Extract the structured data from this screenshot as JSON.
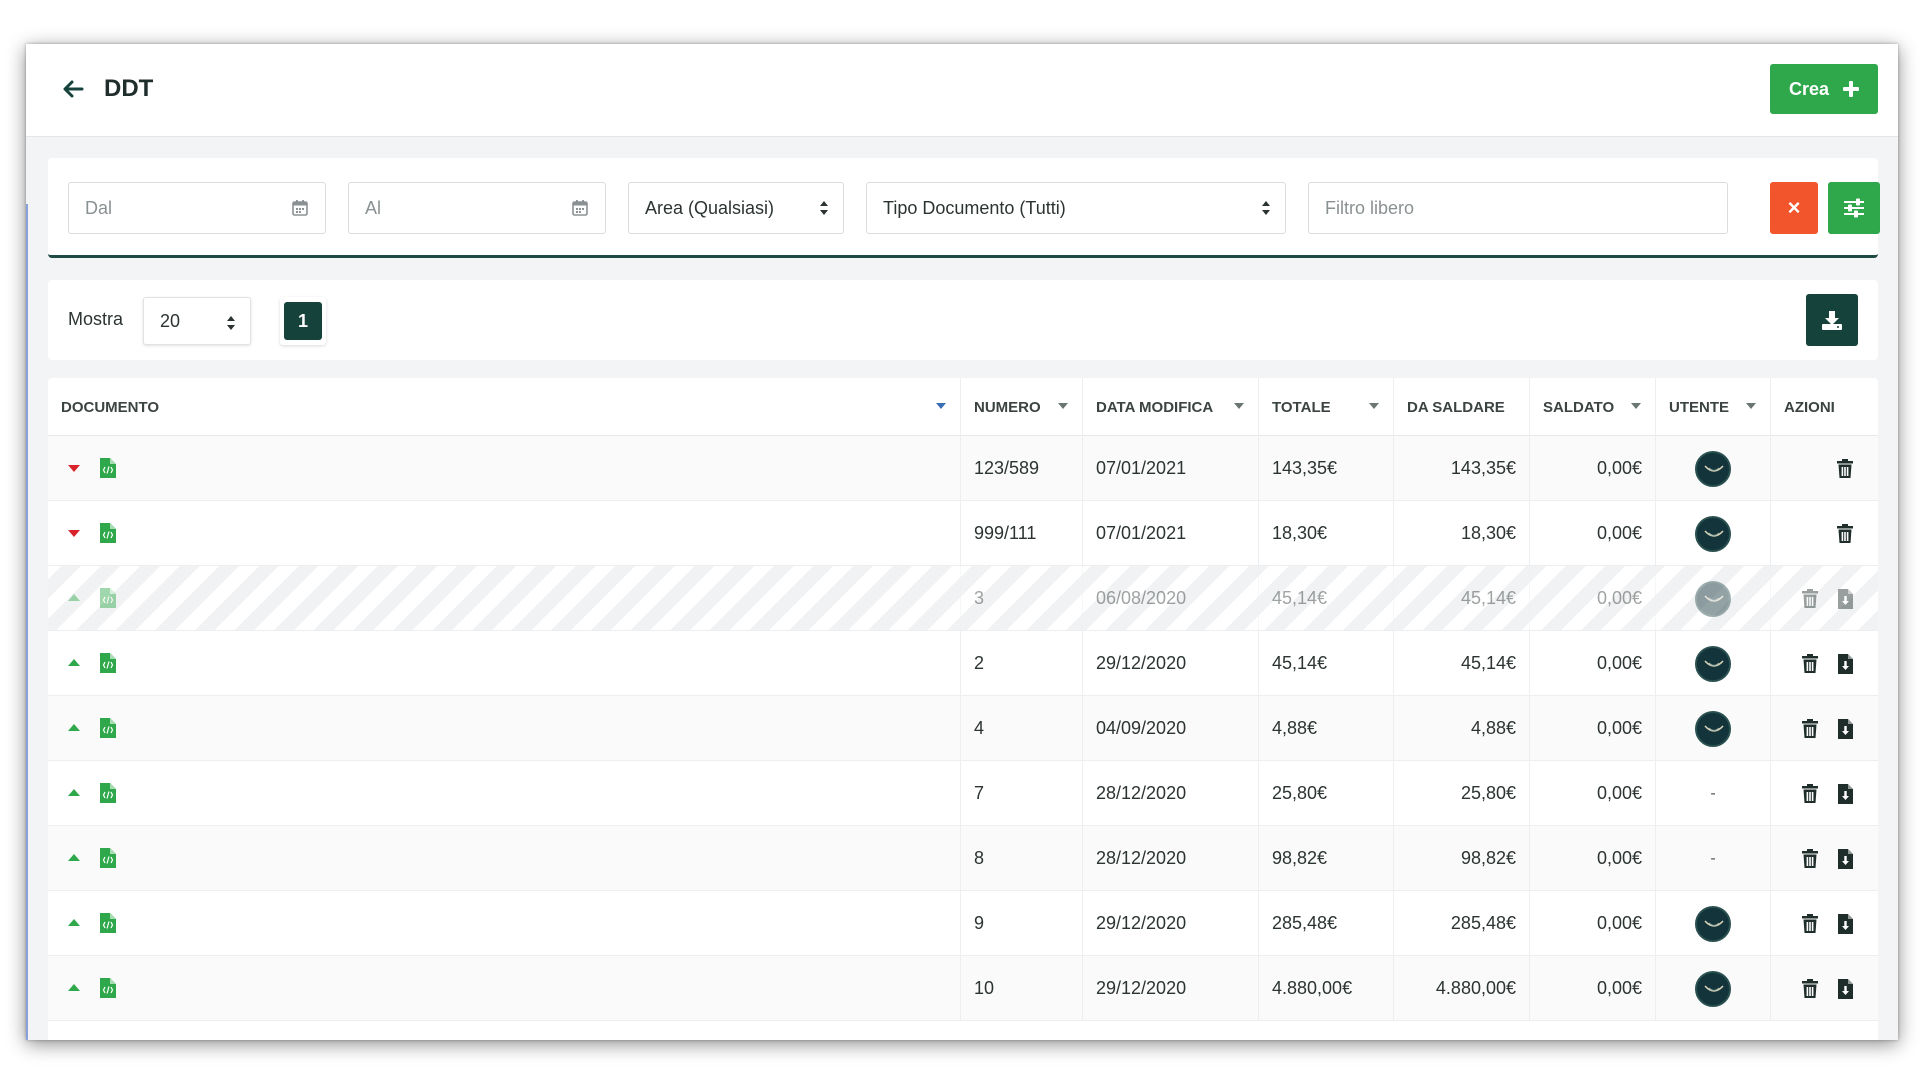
{
  "header": {
    "title": "DDT",
    "create_label": "Crea"
  },
  "filters": {
    "from_placeholder": "Dal",
    "to_placeholder": "Al",
    "area_value": "Area (Qualsiasi)",
    "doc_type_value": "Tipo Documento (Tutti)",
    "free_filter_placeholder": "Filtro libero",
    "clear_label": "×"
  },
  "toolbar": {
    "show_label": "Mostra",
    "page_size": "20",
    "current_page": "1"
  },
  "table": {
    "columns": {
      "documento": "DOCUMENTO",
      "numero": "NUMERO",
      "data_modifica": "DATA MODIFICA",
      "totale": "TOTALE",
      "da_saldare": "DA SALDARE",
      "saldato": "SALDATO",
      "utente": "UTENTE",
      "azioni": "AZIONI"
    },
    "rows": [
      {
        "numero": "123/589",
        "data": "07/01/2021",
        "totale": "143,35€",
        "da_saldare": "143,35€",
        "saldato": "0,00€",
        "user": "avatar",
        "expand": "down",
        "actions": [
          "trash-icon"
        ]
      },
      {
        "numero": "999/111",
        "data": "07/01/2021",
        "totale": "18,30€",
        "da_saldare": "18,30€",
        "saldato": "0,00€",
        "user": "avatar",
        "expand": "down",
        "actions": [
          "trash-icon"
        ]
      },
      {
        "numero": "3",
        "data": "06/08/2020",
        "totale": "45,14€",
        "da_saldare": "45,14€",
        "saldato": "0,00€",
        "user": "avatar",
        "expand": "up",
        "disabled": true,
        "actions": [
          "trash-icon",
          "file-export-icon"
        ]
      },
      {
        "numero": "2",
        "data": "29/12/2020",
        "totale": "45,14€",
        "da_saldare": "45,14€",
        "saldato": "0,00€",
        "user": "avatar",
        "expand": "up",
        "actions": [
          "trash-icon",
          "file-export-icon"
        ]
      },
      {
        "numero": "4",
        "data": "04/09/2020",
        "totale": "4,88€",
        "da_saldare": "4,88€",
        "saldato": "0,00€",
        "user": "avatar",
        "expand": "up",
        "actions": [
          "trash-icon",
          "file-export-icon"
        ]
      },
      {
        "numero": "7",
        "data": "28/12/2020",
        "totale": "25,80€",
        "da_saldare": "25,80€",
        "saldato": "0,00€",
        "user": "-",
        "expand": "up",
        "actions": [
          "trash-icon",
          "file-export-icon"
        ]
      },
      {
        "numero": "8",
        "data": "28/12/2020",
        "totale": "98,82€",
        "da_saldare": "98,82€",
        "saldato": "0,00€",
        "user": "-",
        "expand": "up",
        "actions": [
          "trash-icon",
          "file-export-icon"
        ]
      },
      {
        "numero": "9",
        "data": "29/12/2020",
        "totale": "285,48€",
        "da_saldare": "285,48€",
        "saldato": "0,00€",
        "user": "avatar",
        "expand": "up",
        "actions": [
          "trash-icon",
          "file-export-icon"
        ]
      },
      {
        "numero": "10",
        "data": "29/12/2020",
        "totale": "4.880,00€",
        "da_saldare": "4.880,00€",
        "saldato": "0,00€",
        "user": "avatar",
        "expand": "up",
        "actions": [
          "trash-icon",
          "file-export-icon"
        ]
      }
    ]
  },
  "colors": {
    "green": "#2ea84a",
    "dark_teal": "#15433c",
    "orange": "#f2552b",
    "red": "#d9232b"
  }
}
